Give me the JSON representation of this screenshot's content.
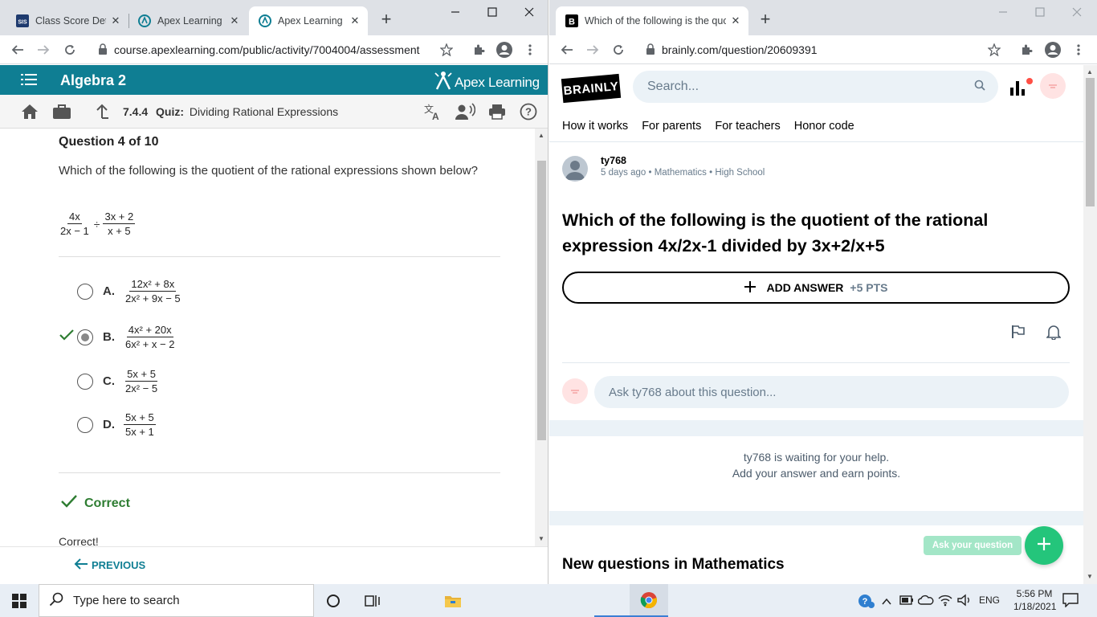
{
  "left": {
    "tabs": [
      {
        "label": "Class Score Deta",
        "favicon": "sis-icon"
      },
      {
        "label": "Apex Learning",
        "favicon": "apex-icon"
      },
      {
        "label": "Apex Learning - ",
        "favicon": "apex-icon"
      }
    ],
    "url": "course.apexlearning.com/public/activity/7004004/assessment",
    "course_title": "Algebra 2",
    "brand": "Apex Learning",
    "quiz_number": "7.4.4",
    "quiz_label": "Quiz:",
    "quiz_title": "Dividing Rational Expressions",
    "question_header": "Question 4 of 10",
    "question_text": "Which of the following is the quotient of the rational expressions shown below?",
    "expression": {
      "left_num": "4x",
      "left_den": "2x − 1",
      "op": "÷",
      "right_num": "3x + 2",
      "right_den": "x + 5"
    },
    "options": [
      {
        "letter": "A.",
        "num": "12x² + 8x",
        "den": "2x² + 9x − 5",
        "selected": false
      },
      {
        "letter": "B.",
        "num": "4x² + 20x",
        "den": "6x² + x − 2",
        "selected": true
      },
      {
        "letter": "C.",
        "num": "5x + 5",
        "den": "2x² − 5",
        "selected": false
      },
      {
        "letter": "D.",
        "num": "5x + 5",
        "den": "5x + 1",
        "selected": false
      }
    ],
    "result_label": "Correct",
    "result_text": "Correct!",
    "prev_label": "PREVIOUS",
    "colors": {
      "header": "#0f7e93",
      "correct": "#2e7d32"
    }
  },
  "right": {
    "tab": {
      "label": "Which of the following is the quo",
      "favicon": "brainly-icon"
    },
    "url": "brainly.com/question/20609391",
    "logo": "BRAINLY",
    "search_placeholder": "Search...",
    "nav": [
      "How it works",
      "For parents",
      "For teachers",
      "Honor code"
    ],
    "user": "ty768",
    "meta": {
      "time": "5 days ago",
      "subject": "Mathematics",
      "level": "High School"
    },
    "question_title": "Which of the following is the quotient of the rational expression 4x/2x-1 divided by 3x+2/x+5",
    "add_answer": "ADD ANSWER",
    "points": "+5 PTS",
    "ask_placeholder": "Ask ty768 about this question...",
    "waiting_line1": "ty768 is waiting for your help.",
    "waiting_line2": "Add your answer and earn points.",
    "new_questions": "New questions in Mathematics",
    "ask_your_question": "Ask your question"
  },
  "taskbar": {
    "search_placeholder": "Type here to search",
    "language": "ENG",
    "time": "5:56 PM",
    "date": "1/18/2021"
  }
}
